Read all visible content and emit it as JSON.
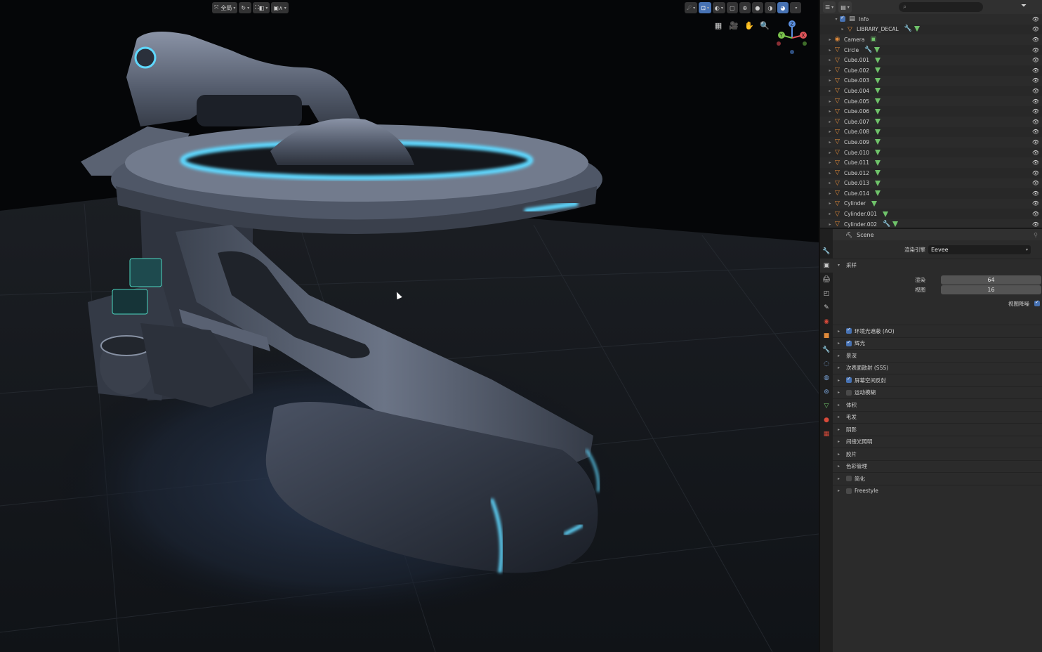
{
  "viewport": {
    "header": {
      "mode_label": "全局",
      "left_buttons": [
        "↻",
        "⛶",
        "◧",
        "▣",
        "∧"
      ],
      "right_buttons": [
        "☄",
        "⊡",
        "◐",
        "▢",
        "⊞"
      ]
    },
    "nav_icons": [
      "▦",
      "🎥",
      "✋",
      "🔍"
    ],
    "gizmo": {
      "x_label": "X",
      "y_label": "Y",
      "z_label": "Z"
    }
  },
  "outliner": {
    "search_placeholder": "",
    "rows": [
      {
        "label": "Info",
        "type": "collection",
        "mods": [],
        "indent": 2
      },
      {
        "label": "LIBRARY_DECAL",
        "type": "mesh",
        "mods": [
          "wrench",
          "tri"
        ],
        "indent": 3
      },
      {
        "label": "Camera",
        "type": "camera",
        "mods": [
          "cam"
        ],
        "indent": 1
      },
      {
        "label": "Circle",
        "type": "mesh",
        "mods": [
          "wrench",
          "tri"
        ],
        "indent": 1
      },
      {
        "label": "Cube.001",
        "type": "mesh",
        "mods": [
          "tri"
        ],
        "indent": 1
      },
      {
        "label": "Cube.002",
        "type": "mesh",
        "mods": [
          "tri"
        ],
        "indent": 1
      },
      {
        "label": "Cube.003",
        "type": "mesh",
        "mods": [
          "tri"
        ],
        "indent": 1
      },
      {
        "label": "Cube.004",
        "type": "mesh",
        "mods": [
          "tri"
        ],
        "indent": 1
      },
      {
        "label": "Cube.005",
        "type": "mesh",
        "mods": [
          "tri"
        ],
        "indent": 1
      },
      {
        "label": "Cube.006",
        "type": "mesh",
        "mods": [
          "tri"
        ],
        "indent": 1
      },
      {
        "label": "Cube.007",
        "type": "mesh",
        "mods": [
          "tri"
        ],
        "indent": 1
      },
      {
        "label": "Cube.008",
        "type": "mesh",
        "mods": [
          "tri"
        ],
        "indent": 1
      },
      {
        "label": "Cube.009",
        "type": "mesh",
        "mods": [
          "tri"
        ],
        "indent": 1
      },
      {
        "label": "Cube.010",
        "type": "mesh",
        "mods": [
          "tri"
        ],
        "indent": 1
      },
      {
        "label": "Cube.011",
        "type": "mesh",
        "mods": [
          "tri"
        ],
        "indent": 1
      },
      {
        "label": "Cube.012",
        "type": "mesh",
        "mods": [
          "tri"
        ],
        "indent": 1
      },
      {
        "label": "Cube.013",
        "type": "mesh",
        "mods": [
          "tri"
        ],
        "indent": 1
      },
      {
        "label": "Cube.014",
        "type": "mesh",
        "mods": [
          "tri"
        ],
        "indent": 1
      },
      {
        "label": "Cylinder",
        "type": "mesh",
        "mods": [
          "tri"
        ],
        "indent": 1
      },
      {
        "label": "Cylinder.001",
        "type": "mesh",
        "mods": [
          "tri"
        ],
        "indent": 1
      },
      {
        "label": "Cylinder.002",
        "type": "mesh",
        "mods": [
          "wrench",
          "tri"
        ],
        "indent": 1
      }
    ]
  },
  "properties": {
    "scene_label": "Scene",
    "render_engine_label": "渲染引擎",
    "render_engine_value": "Eevee",
    "sampling": {
      "title": "采样",
      "render_label": "渲染",
      "render_value": "64",
      "viewport_label": "视图",
      "viewport_value": "16",
      "denoise_label": "视图降噪"
    },
    "panels": [
      {
        "label": "环境光遮蔽 (AO)",
        "checkbox": true,
        "checked": true
      },
      {
        "label": "辉光",
        "checkbox": true,
        "checked": true
      },
      {
        "label": "景深",
        "checkbox": false,
        "checked": false
      },
      {
        "label": "次表面散射 (SSS)",
        "checkbox": false,
        "checked": false
      },
      {
        "label": "屏幕空间反射",
        "checkbox": true,
        "checked": true
      },
      {
        "label": "运动模糊",
        "checkbox": true,
        "checked": false
      },
      {
        "label": "体积",
        "checkbox": false,
        "checked": false
      },
      {
        "label": "毛发",
        "checkbox": false,
        "checked": false
      },
      {
        "label": "阴影",
        "checkbox": false,
        "checked": false
      },
      {
        "label": "间接光照明",
        "checkbox": false,
        "checked": false
      },
      {
        "label": "胶片",
        "checkbox": false,
        "checked": false
      },
      {
        "label": "色彩管理",
        "checkbox": false,
        "checked": false
      },
      {
        "label": "简化",
        "checkbox": true,
        "checked": false
      },
      {
        "label": "Freestyle",
        "checkbox": true,
        "checked": false
      }
    ],
    "tab_colors": [
      "#c8c8c8",
      "#c8c8c8",
      "#c8c8c8",
      "#c8c8c8",
      "#c8c8c8",
      "#d84a3a",
      "#e08a3a",
      "#7aa4d8",
      "#7aa4d8",
      "#7aa4d8",
      "#7aa4d8",
      "#6fc36a",
      "#d84a3a",
      "#d84a3a"
    ]
  },
  "colors": {
    "accent": "#4772b3",
    "glow": "#5fd8ff",
    "object_orange": "#e08a3a",
    "modifier_green": "#6fc36a"
  }
}
